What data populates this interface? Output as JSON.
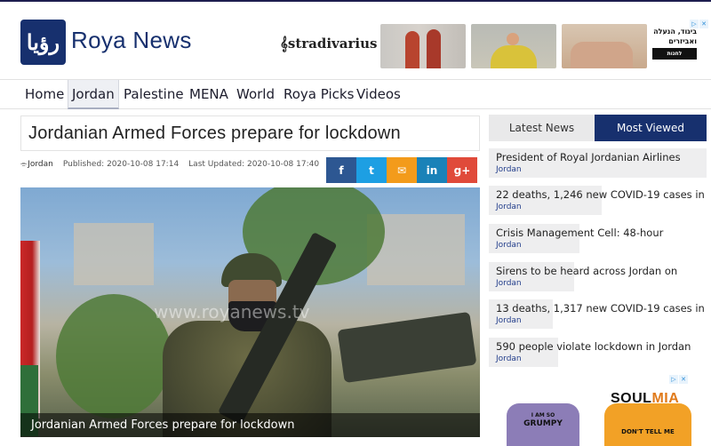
{
  "site": {
    "logo_text": "رؤيا",
    "brand": "Roya News"
  },
  "ad_banner": {
    "brand": "stradivarius",
    "hebrew_lines": [
      "ביגוד, הנעלה",
      "ואביזרים"
    ],
    "shop_label": "לחנות",
    "close_icons": [
      "▷",
      "✕"
    ]
  },
  "nav": {
    "items": [
      "Home",
      "Jordan",
      "Palestine",
      "MENA",
      "World",
      "Roya Picks",
      "Videos"
    ],
    "active": "Jordan"
  },
  "article": {
    "title": "Jordanian Armed Forces prepare for lockdown",
    "category": "Jordan",
    "published": "Published: 2020-10-08 17:14",
    "updated": "Last Updated: 2020-10-08 17:40",
    "share": {
      "facebook": "f",
      "twitter": "t",
      "email": "✉",
      "linkedin": "in",
      "google": "g+"
    },
    "image_watermark": "www.royanews.tv",
    "image_caption": "Jordanian Armed Forces prepare for lockdown"
  },
  "sidebar": {
    "tabs": {
      "latest": "Latest News",
      "most_viewed": "Most Viewed"
    },
    "active_tab": "Most Viewed",
    "items": [
      {
        "title": "President of Royal Jordanian Airlines",
        "category": "Jordan"
      },
      {
        "title": "22 deaths, 1,246 new COVID-19 cases in",
        "category": "Jordan"
      },
      {
        "title": "Crisis Management Cell: 48-hour",
        "category": "Jordan"
      },
      {
        "title": "Sirens to be heard across Jordan on",
        "category": "Jordan"
      },
      {
        "title": "13 deaths, 1,317 new COVID-19 cases in",
        "category": "Jordan"
      },
      {
        "title": "590 people violate lockdown in Jordan",
        "category": "Jordan"
      }
    ]
  },
  "side_ad": {
    "brand_main": "SOUL",
    "brand_accent": "MIA",
    "shirt1_text": "GRUMPY",
    "shirt1_small": "I AM SO",
    "shirt2_text": "DON'T TELL ME",
    "close_icons": [
      "▷",
      "✕"
    ]
  },
  "colors": {
    "brand_blue": "#17306e",
    "facebook": "#2d5792",
    "twitter": "#1d9fe3",
    "email": "#f39b1b",
    "linkedin": "#1a82b8",
    "google": "#e04a3a"
  }
}
